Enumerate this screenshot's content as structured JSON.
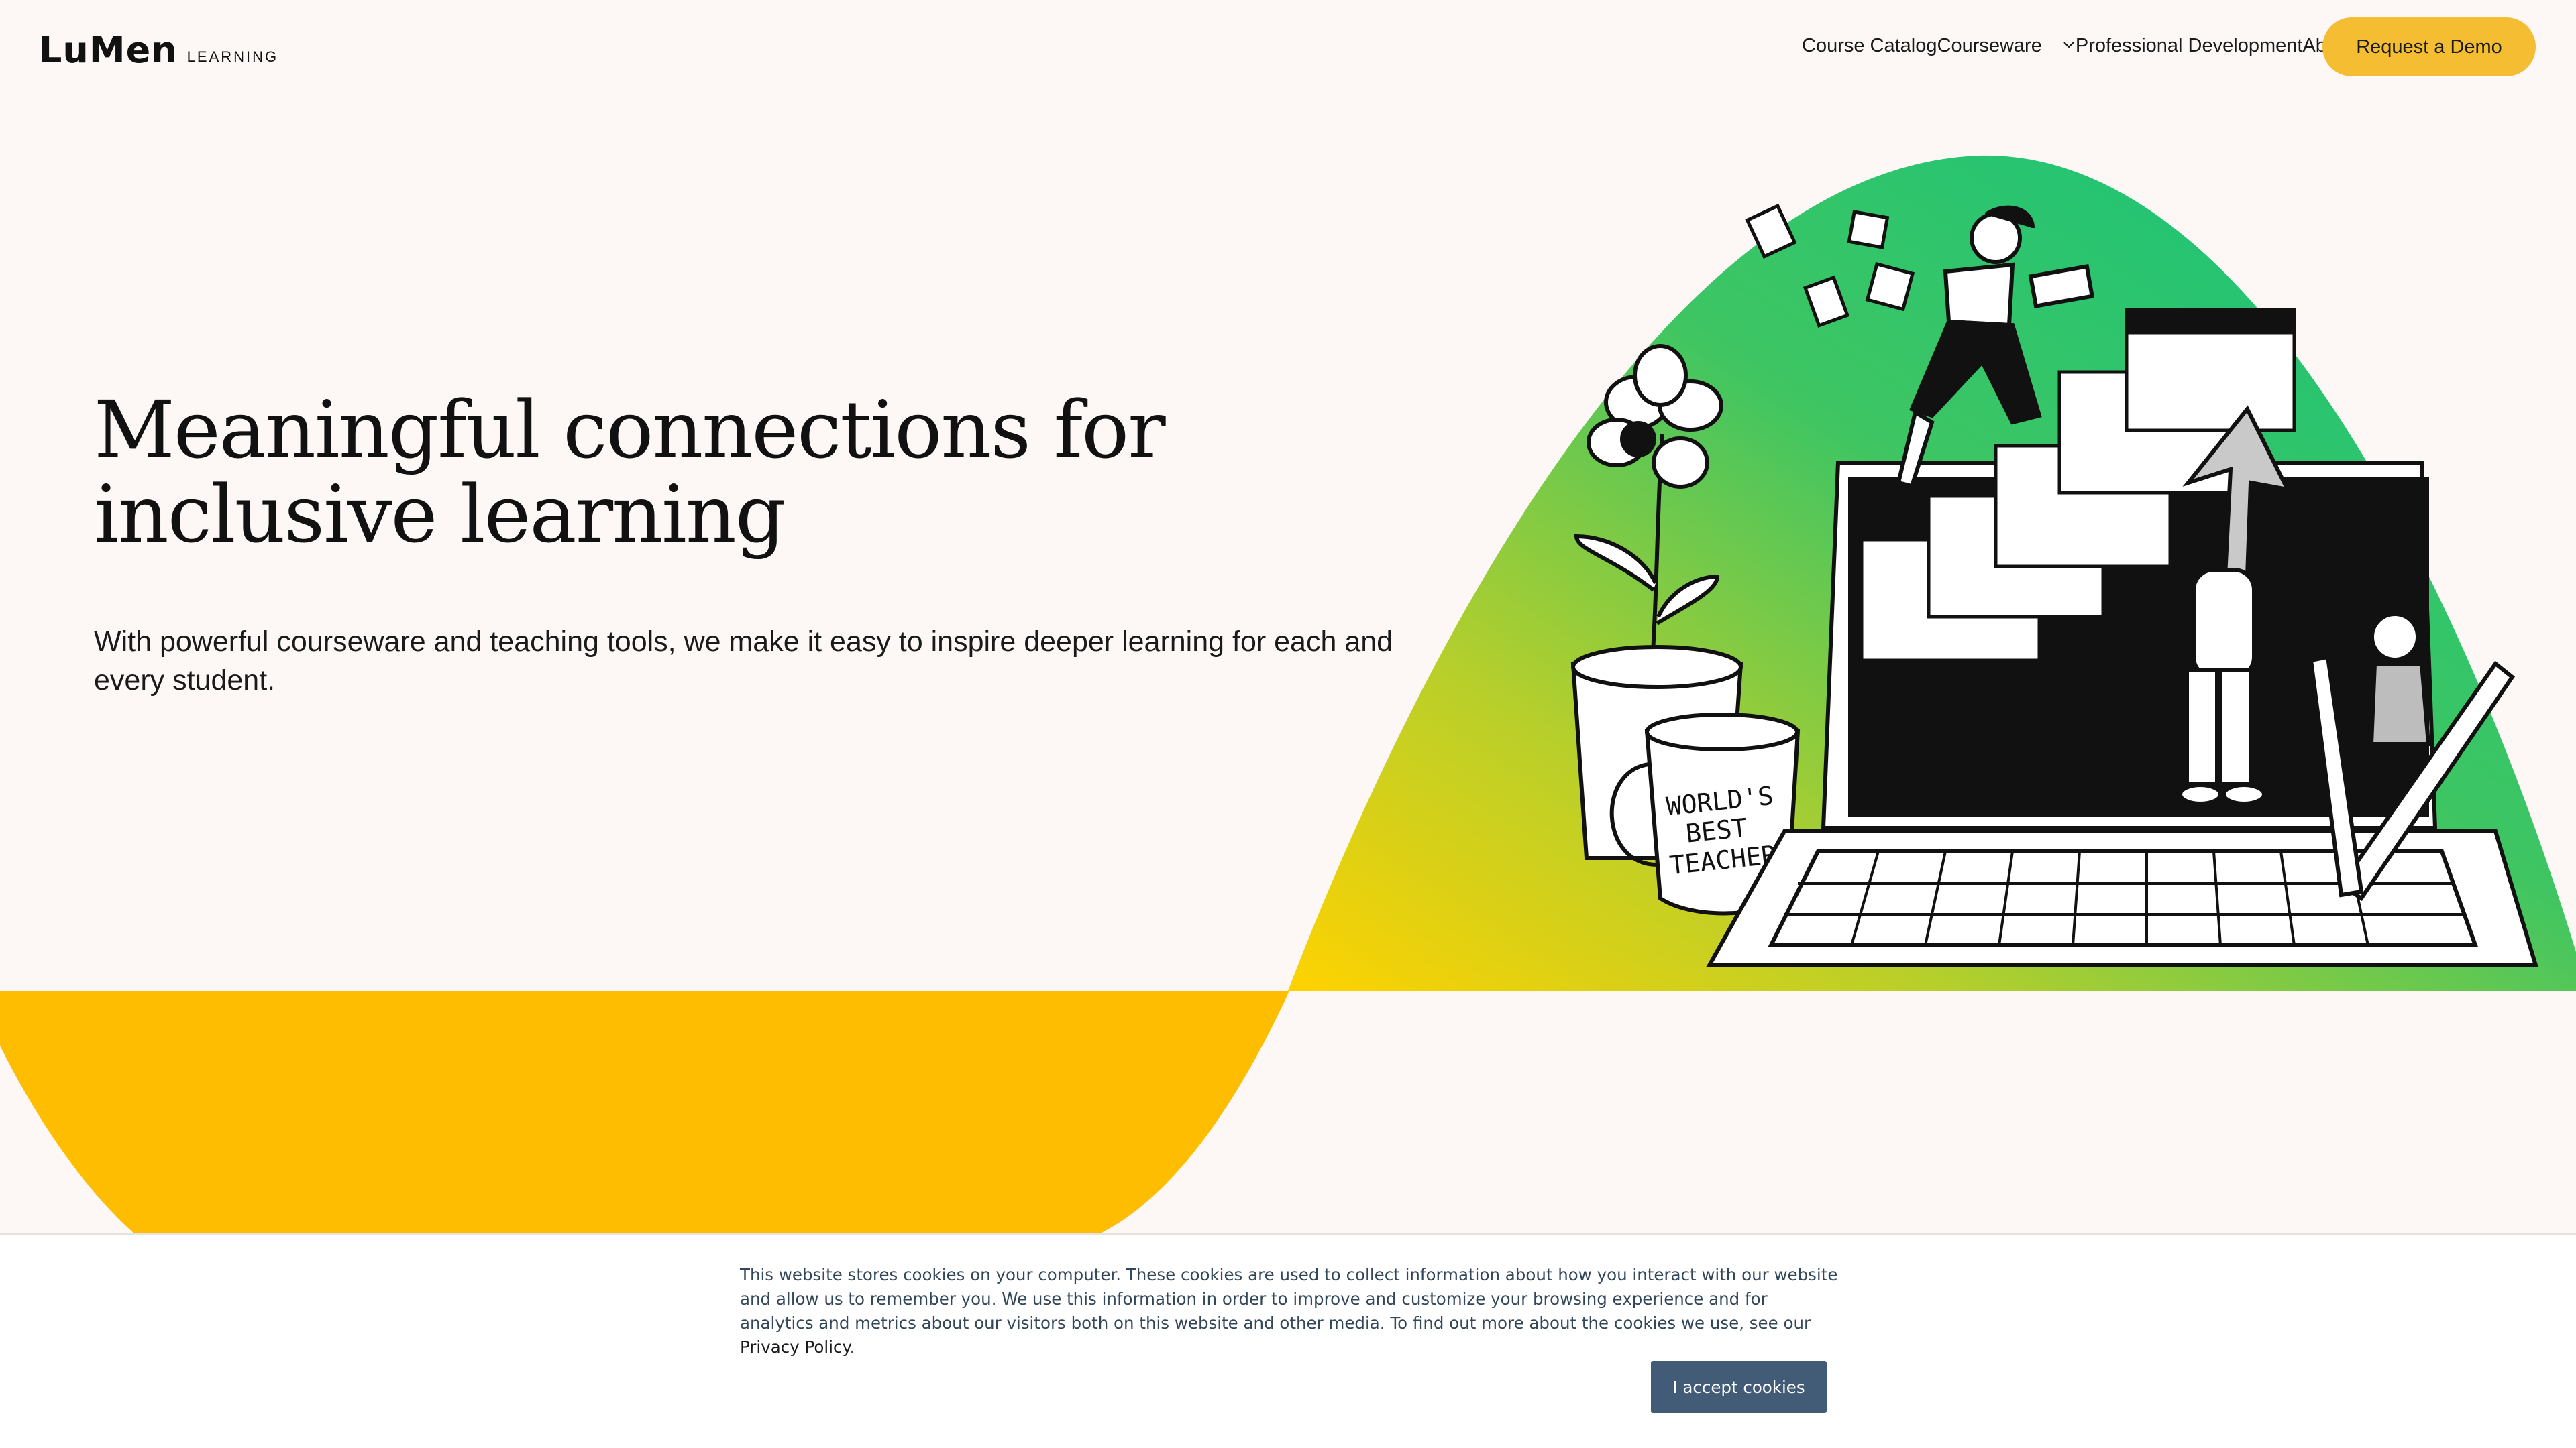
{
  "brand": {
    "name": "LuMen",
    "sub": "LEARNING"
  },
  "nav": {
    "links": [
      "Course Catalog",
      "Courseware",
      "Professional Development",
      "About"
    ],
    "cta": "Request a Demo"
  },
  "hero": {
    "headline": "Meaningful connections for inclusive learning",
    "subhead": "With powerful courseware and teaching tools, we make it easy to inspire deeper learning for each and every student.",
    "mug_text": [
      "WORLD'S",
      "BEST",
      "TEACHER"
    ]
  },
  "cookie": {
    "text": "This website stores cookies on your computer. These cookies are used to collect information about how you interact with our website and allow us to remember you. We use this information in order to improve and customize your browsing experience and for analytics and metrics about our visitors both on this website and other media. To find out more about the cookies we use, see our",
    "link": "Privacy Policy",
    "button": "I accept cookies"
  },
  "colors": {
    "background": "#fdf8f6",
    "accent_yellow": "#f4bd32",
    "hero_green": "#1dc37e",
    "hero_yellow": "#ffbd00",
    "cookie_button": "#425b76"
  }
}
